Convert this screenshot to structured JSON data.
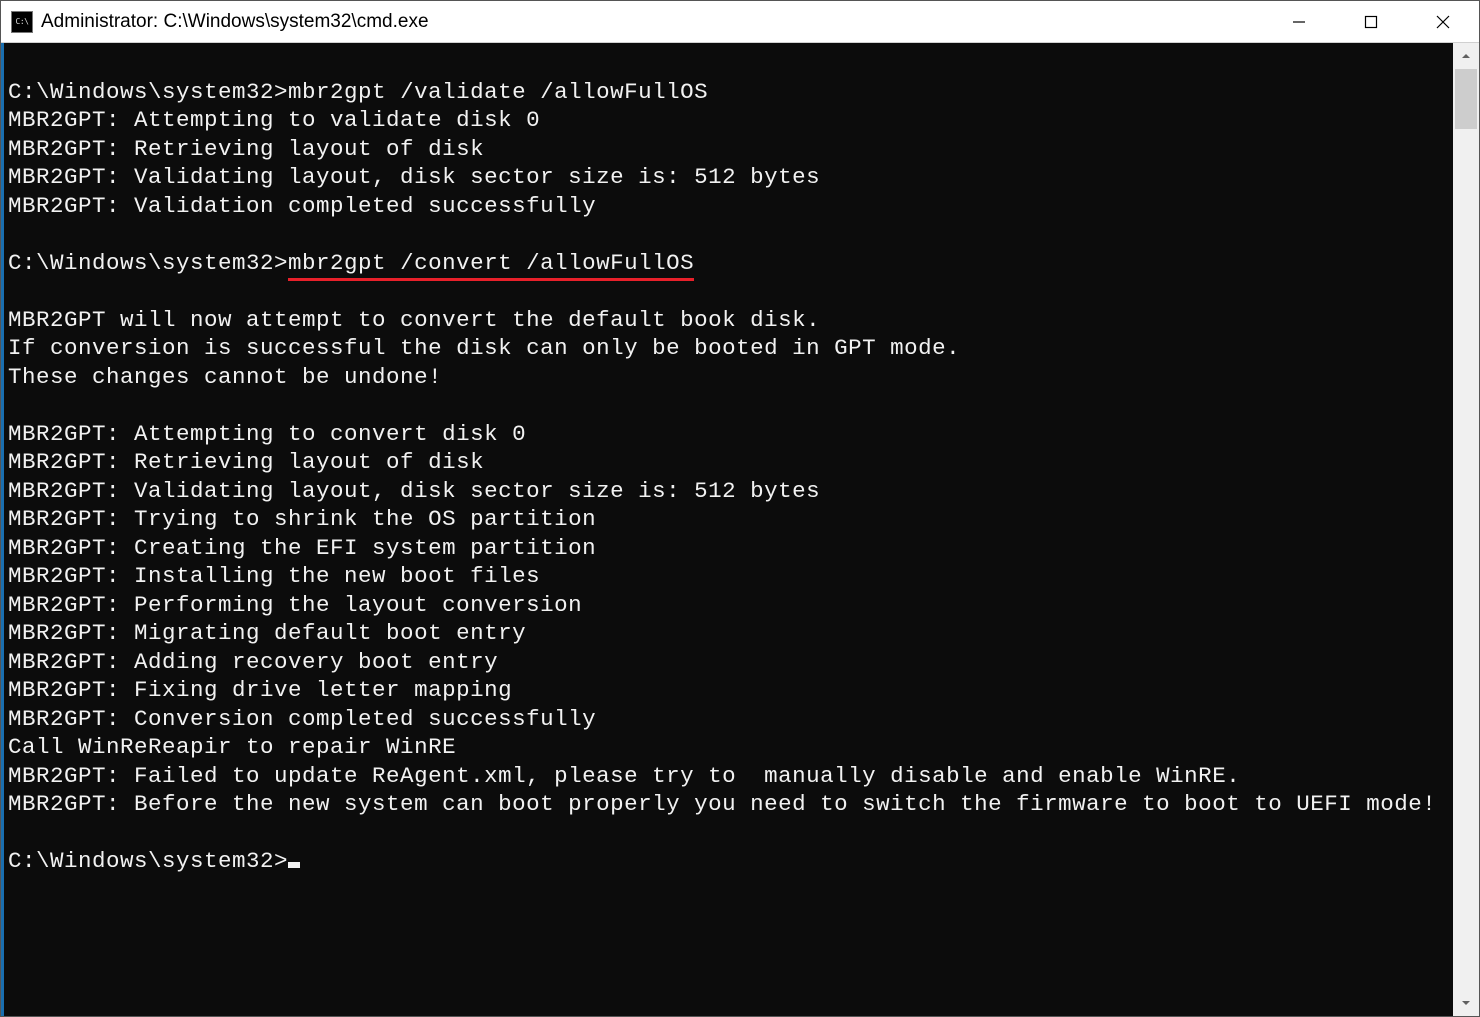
{
  "window": {
    "title": "Administrator: C:\\Windows\\system32\\cmd.exe"
  },
  "icons": {
    "minimize": "minimize-icon",
    "maximize": "maximize-icon",
    "close": "close-icon",
    "scroll_up": "scroll-up-icon",
    "scroll_down": "scroll-down-icon",
    "app": "cmd-app-icon"
  },
  "console": {
    "prompt_path": "C:\\Windows\\system32>",
    "command1": "mbr2gpt /validate /allowFullOS",
    "command2": "mbr2gpt /convert /allowFullOS",
    "output1": [
      "MBR2GPT: Attempting to validate disk 0",
      "MBR2GPT: Retrieving layout of disk",
      "MBR2GPT: Validating layout, disk sector size is: 512 bytes",
      "MBR2GPT: Validation completed successfully"
    ],
    "output2a": [
      "MBR2GPT will now attempt to convert the default book disk.",
      "If conversion is successful the disk can only be booted in GPT mode.",
      "These changes cannot be undone!"
    ],
    "output2b": [
      "MBR2GPT: Attempting to convert disk 0",
      "MBR2GPT: Retrieving layout of disk",
      "MBR2GPT: Validating layout, disk sector size is: 512 bytes",
      "MBR2GPT: Trying to shrink the OS partition",
      "MBR2GPT: Creating the EFI system partition",
      "MBR2GPT: Installing the new boot files",
      "MBR2GPT: Performing the layout conversion",
      "MBR2GPT: Migrating default boot entry",
      "MBR2GPT: Adding recovery boot entry",
      "MBR2GPT: Fixing drive letter mapping",
      "MBR2GPT: Conversion completed successfully",
      "Call WinReReapir to repair WinRE",
      "MBR2GPT: Failed to update ReAgent.xml, please try to  manually disable and enable WinRE.",
      "MBR2GPT: Before the new system can boot properly you need to switch the firmware to boot to UEFI mode!"
    ]
  }
}
